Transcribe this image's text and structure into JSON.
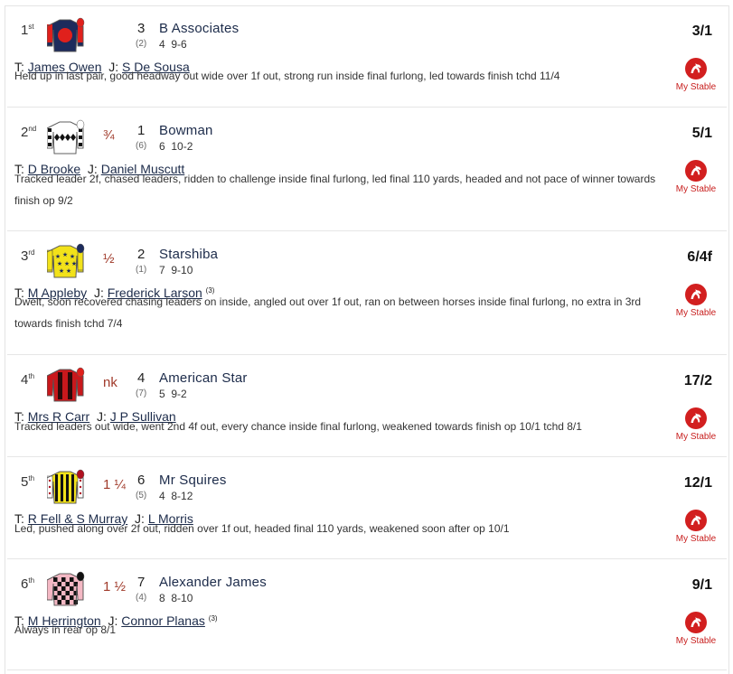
{
  "runners": [
    {
      "pos_num": "1",
      "pos_suffix": "st",
      "distance": "",
      "number": "3",
      "draw": "(2)",
      "name": "B Associates",
      "age": "4",
      "weight": "9-6",
      "odds": "3/1",
      "trainer_label": "T:",
      "trainer": "James Owen",
      "jockey_label": "J:",
      "jockey": "S De Sousa",
      "claim": "",
      "comment": "Held up in last pair, good headway out wide over 1f out, strong run inside final furlong, led towards finish tchd 11/4",
      "stable_label": "My Stable",
      "silk": {
        "pattern": "target",
        "body": "#1d2b5c",
        "accent": "#e0201c",
        "cap": "#e0201c"
      }
    },
    {
      "pos_num": "2",
      "pos_suffix": "nd",
      "distance": "¾",
      "number": "1",
      "draw": "(6)",
      "name": "Bowman",
      "age": "6",
      "weight": "10-2",
      "odds": "5/1",
      "trainer_label": "T:",
      "trainer": "D Brooke",
      "jockey_label": "J:",
      "jockey": "Daniel Muscutt",
      "claim": "",
      "comment": "Tracked leader 2f, chased leaders, ridden to challenge inside final furlong, led final 110 yards, headed and not pace of winner towards finish op 9/2",
      "stable_label": "My Stable",
      "silk": {
        "pattern": "diamonds",
        "body": "#ffffff",
        "accent": "#111111",
        "cap": "#ffffff"
      }
    },
    {
      "pos_num": "3",
      "pos_suffix": "rd",
      "distance": "½",
      "number": "2",
      "draw": "(1)",
      "name": "Starshiba",
      "age": "7",
      "weight": "9-10",
      "odds": "6/4f",
      "trainer_label": "T:",
      "trainer": "M Appleby",
      "jockey_label": "J:",
      "jockey": "Frederick Larson",
      "claim": "(3)",
      "comment": "Dwelt, soon recovered chasing leaders on inside, angled out over 1f out, ran on between horses inside final furlong, no extra in 3rd towards finish tchd 7/4",
      "stable_label": "My Stable",
      "silk": {
        "pattern": "stars",
        "body": "#f2e21a",
        "accent": "#1d2b5c",
        "cap": "#1d2b5c"
      }
    },
    {
      "pos_num": "4",
      "pos_suffix": "th",
      "distance": "nk",
      "number": "4",
      "draw": "(7)",
      "name": "American Star",
      "age": "5",
      "weight": "9-2",
      "odds": "17/2",
      "trainer_label": "T:",
      "trainer": "Mrs R Carr",
      "jockey_label": "J:",
      "jockey": "J P Sullivan",
      "claim": "",
      "comment": "Tracked leaders out wide, went 2nd 4f out, every chance inside final furlong, weakened towards finish op 10/1 tchd 8/1",
      "stable_label": "My Stable",
      "silk": {
        "pattern": "braces",
        "body": "#c8181c",
        "accent": "#2a0a0a",
        "cap": "#e0201c"
      }
    },
    {
      "pos_num": "5",
      "pos_suffix": "th",
      "distance": "1 ¼",
      "number": "6",
      "draw": "(5)",
      "name": "Mr Squires",
      "age": "4",
      "weight": "8-12",
      "odds": "12/1",
      "trainer_label": "T:",
      "trainer": "R Fell & S Murray",
      "jockey_label": "J:",
      "jockey": "L Morris",
      "claim": "",
      "comment": "Led, pushed along over 2f out, ridden over 1f out, headed final 110 yards, weakened soon after op 10/1",
      "stable_label": "My Stable",
      "silk": {
        "pattern": "stripes",
        "body": "#f2e21a",
        "accent": "#111111",
        "cap": "#b01020"
      }
    },
    {
      "pos_num": "6",
      "pos_suffix": "th",
      "distance": "1 ½",
      "number": "7",
      "draw": "(4)",
      "name": "Alexander James",
      "age": "8",
      "weight": "8-10",
      "odds": "9/1",
      "trainer_label": "T:",
      "trainer": "M Herrington",
      "jockey_label": "J:",
      "jockey": "Connor Planas",
      "claim": "(3)",
      "comment": "Always in rear op 8/1",
      "stable_label": "My Stable",
      "silk": {
        "pattern": "checks",
        "body": "#f4b8c4",
        "accent": "#111111",
        "cap": "#111111"
      }
    }
  ]
}
